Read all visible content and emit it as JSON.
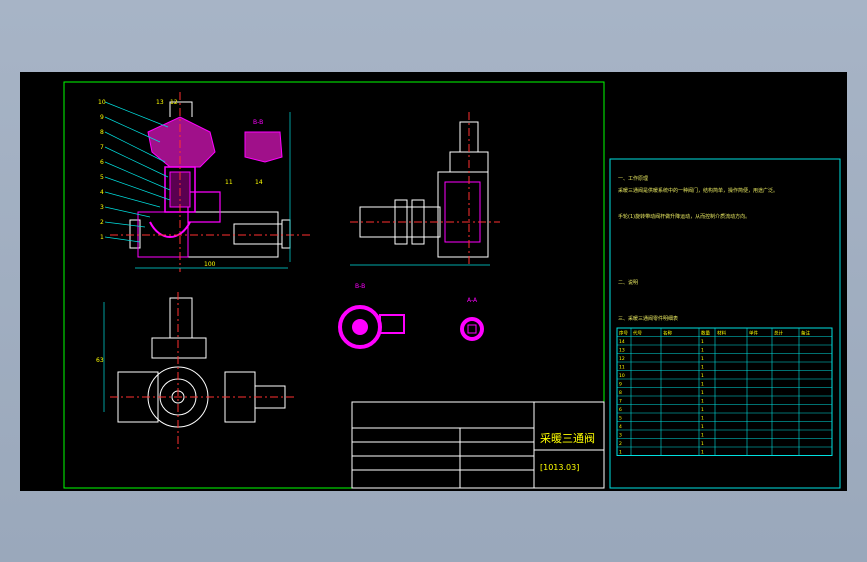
{
  "drawing": {
    "title_block": {
      "name": "采暖三通阀",
      "drawing_number": "[1013.03]"
    },
    "sections": {
      "bb_top": "B-B",
      "bb_mid": "B-B",
      "aa": "A-A"
    },
    "balloons": [
      "10",
      "9",
      "8",
      "7",
      "6",
      "5",
      "4",
      "3",
      "2",
      "1"
    ],
    "top_balloons": [
      "13",
      "12"
    ],
    "callouts": [
      "11",
      "14"
    ],
    "dimensions": {
      "overall_len": "100",
      "height_view": "63"
    },
    "notes": {
      "heading": "一、工作原理",
      "body": [
        "采暖三通阀是供暖系统中的一种阀门，结构简单，操作简便，用途广泛。",
        "手轮(1)旋转带动阀杆做升降运动，从而控制介质流动方向。"
      ],
      "heading2": "二、说明",
      "heading3": "三、采暖三通阀零件明细表"
    },
    "bom": {
      "headers": [
        "序号",
        "代号",
        "名称",
        "数量",
        "材料",
        "单件",
        "总计",
        "备注"
      ],
      "rows": [
        {
          "no": "14",
          "code": "",
          "name": "",
          "qty": "1",
          "mat": ""
        },
        {
          "no": "13",
          "code": "",
          "name": "",
          "qty": "1",
          "mat": ""
        },
        {
          "no": "12",
          "code": "",
          "name": "",
          "qty": "1",
          "mat": ""
        },
        {
          "no": "11",
          "code": "",
          "name": "",
          "qty": "1",
          "mat": ""
        },
        {
          "no": "10",
          "code": "",
          "name": "",
          "qty": "1",
          "mat": ""
        },
        {
          "no": "9",
          "code": "",
          "name": "",
          "qty": "1",
          "mat": ""
        },
        {
          "no": "8",
          "code": "",
          "name": "",
          "qty": "1",
          "mat": ""
        },
        {
          "no": "7",
          "code": "",
          "name": "",
          "qty": "1",
          "mat": ""
        },
        {
          "no": "6",
          "code": "",
          "name": "",
          "qty": "1",
          "mat": ""
        },
        {
          "no": "5",
          "code": "",
          "name": "",
          "qty": "1",
          "mat": ""
        },
        {
          "no": "4",
          "code": "",
          "name": "",
          "qty": "1",
          "mat": ""
        },
        {
          "no": "3",
          "code": "",
          "name": "",
          "qty": "1",
          "mat": ""
        },
        {
          "no": "2",
          "code": "",
          "name": "",
          "qty": "1",
          "mat": ""
        },
        {
          "no": "1",
          "code": "",
          "name": "",
          "qty": "1",
          "mat": ""
        }
      ]
    },
    "colors": {
      "background": "#000000",
      "border": "#00ff00",
      "outline": "#ffffff",
      "section": "#ff00ff",
      "center": "#ff3030",
      "dimension": "#00e0e0",
      "text": "#ffff00"
    }
  }
}
